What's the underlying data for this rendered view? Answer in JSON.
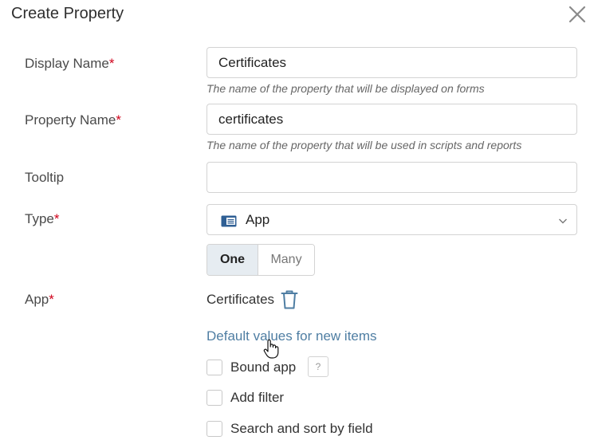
{
  "dialog": {
    "title": "Create Property"
  },
  "fields": {
    "display_name": {
      "label": "Display Name",
      "required_mark": "*",
      "value": "Certificates",
      "hint": "The name of the property that will be displayed on forms"
    },
    "property_name": {
      "label": "Property Name",
      "required_mark": "*",
      "value": "certificates",
      "hint": "The name of the property that will be used in scripts and reports"
    },
    "tooltip": {
      "label": "Tooltip",
      "value": ""
    },
    "type": {
      "label": "Type",
      "required_mark": "*",
      "value": "App",
      "icon": "app-icon"
    },
    "cardinality": {
      "options": [
        "One",
        "Many"
      ],
      "selected": "One"
    },
    "app": {
      "label": "App",
      "required_mark": "*",
      "value": "Certificates",
      "delete_icon": "trash-icon"
    }
  },
  "links": {
    "default_values": "Default values for new items"
  },
  "options": {
    "bound_app": {
      "label": "Bound app",
      "checked": false,
      "help": "?"
    },
    "add_filter": {
      "label": "Add filter",
      "checked": false
    },
    "search_sort": {
      "label": "Search and sort by field",
      "checked": false
    }
  },
  "colors": {
    "required": "#d0021b",
    "link": "#4f7ea3",
    "app_icon": "#2f5f94",
    "segment_selected_bg": "#e6ecf1"
  }
}
